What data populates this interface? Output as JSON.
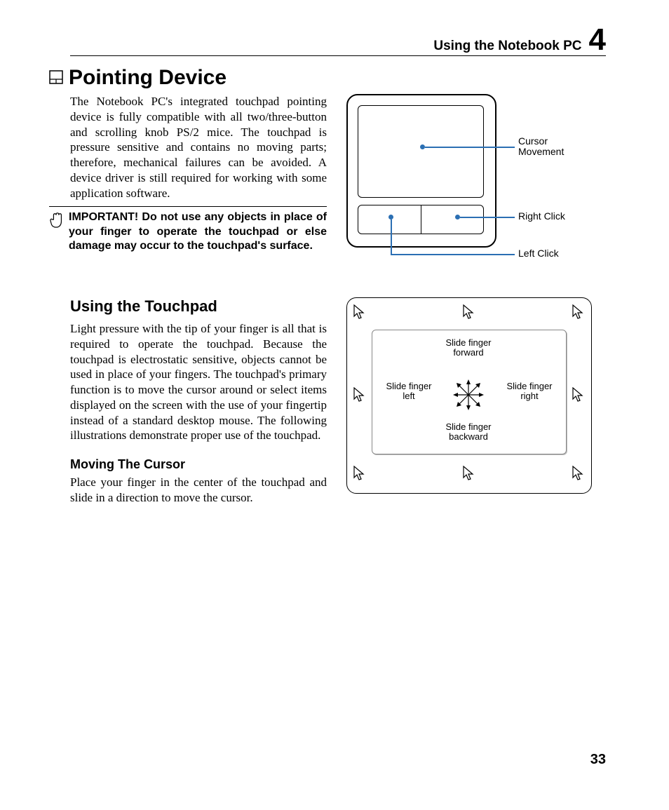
{
  "header": {
    "running": "Using the Notebook PC",
    "chapter": "4"
  },
  "sec1": {
    "title": "Pointing Device",
    "body": "The Notebook PC's integrated touchpad pointing device is fully compatible with all two/three-button and scrolling knob PS/2 mice. The touchpad is pressure sensitive and contains no moving parts; therefore, mechanical failures can be avoided. A device driver is still required for working with some application software.",
    "note": "IMPORTANT! Do not use any objects in place of your finger to operate the touchpad or else damage may occur to the touchpad's surface."
  },
  "fig1": {
    "l1": "Cursor",
    "l1b": "Movement",
    "l2": "Right Click",
    "l3": "Left Click"
  },
  "sec2": {
    "title": "Using the Touchpad",
    "body": "Light pressure with the tip of your finger is all that is required to operate the touchpad. Because the touchpad is electrostatic sensitive, objects cannot be used in place of your fingers. The touchpad's primary function is to move the cursor around or select items displayed on the screen with the use of your fingertip instead of a standard desktop mouse. The following illustrations demonstrate proper use of the touchpad.",
    "sub": "Moving The Cursor",
    "sub_body": "Place your finger in the center of the touchpad and slide in a direction to move the cursor."
  },
  "fig2": {
    "up": "Slide finger\nforward",
    "down": "Slide finger\nbackward",
    "left": "Slide finger\nleft",
    "right": "Slide finger\nright"
  },
  "page_number": "33"
}
